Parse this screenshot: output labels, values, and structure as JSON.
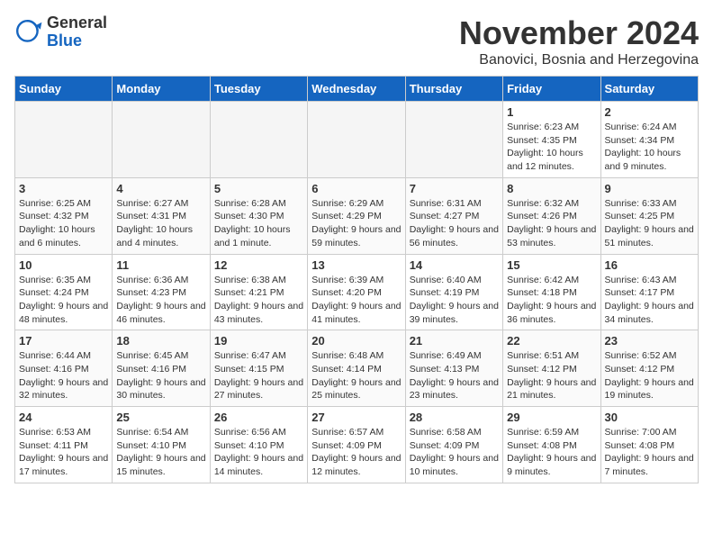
{
  "logo": {
    "general": "General",
    "blue": "Blue"
  },
  "header": {
    "month": "November 2024",
    "location": "Banovici, Bosnia and Herzegovina"
  },
  "weekdays": [
    "Sunday",
    "Monday",
    "Tuesday",
    "Wednesday",
    "Thursday",
    "Friday",
    "Saturday"
  ],
  "weeks": [
    [
      {
        "day": "",
        "info": ""
      },
      {
        "day": "",
        "info": ""
      },
      {
        "day": "",
        "info": ""
      },
      {
        "day": "",
        "info": ""
      },
      {
        "day": "",
        "info": ""
      },
      {
        "day": "1",
        "info": "Sunrise: 6:23 AM\nSunset: 4:35 PM\nDaylight: 10 hours and 12 minutes."
      },
      {
        "day": "2",
        "info": "Sunrise: 6:24 AM\nSunset: 4:34 PM\nDaylight: 10 hours and 9 minutes."
      }
    ],
    [
      {
        "day": "3",
        "info": "Sunrise: 6:25 AM\nSunset: 4:32 PM\nDaylight: 10 hours and 6 minutes."
      },
      {
        "day": "4",
        "info": "Sunrise: 6:27 AM\nSunset: 4:31 PM\nDaylight: 10 hours and 4 minutes."
      },
      {
        "day": "5",
        "info": "Sunrise: 6:28 AM\nSunset: 4:30 PM\nDaylight: 10 hours and 1 minute."
      },
      {
        "day": "6",
        "info": "Sunrise: 6:29 AM\nSunset: 4:29 PM\nDaylight: 9 hours and 59 minutes."
      },
      {
        "day": "7",
        "info": "Sunrise: 6:31 AM\nSunset: 4:27 PM\nDaylight: 9 hours and 56 minutes."
      },
      {
        "day": "8",
        "info": "Sunrise: 6:32 AM\nSunset: 4:26 PM\nDaylight: 9 hours and 53 minutes."
      },
      {
        "day": "9",
        "info": "Sunrise: 6:33 AM\nSunset: 4:25 PM\nDaylight: 9 hours and 51 minutes."
      }
    ],
    [
      {
        "day": "10",
        "info": "Sunrise: 6:35 AM\nSunset: 4:24 PM\nDaylight: 9 hours and 48 minutes."
      },
      {
        "day": "11",
        "info": "Sunrise: 6:36 AM\nSunset: 4:23 PM\nDaylight: 9 hours and 46 minutes."
      },
      {
        "day": "12",
        "info": "Sunrise: 6:38 AM\nSunset: 4:21 PM\nDaylight: 9 hours and 43 minutes."
      },
      {
        "day": "13",
        "info": "Sunrise: 6:39 AM\nSunset: 4:20 PM\nDaylight: 9 hours and 41 minutes."
      },
      {
        "day": "14",
        "info": "Sunrise: 6:40 AM\nSunset: 4:19 PM\nDaylight: 9 hours and 39 minutes."
      },
      {
        "day": "15",
        "info": "Sunrise: 6:42 AM\nSunset: 4:18 PM\nDaylight: 9 hours and 36 minutes."
      },
      {
        "day": "16",
        "info": "Sunrise: 6:43 AM\nSunset: 4:17 PM\nDaylight: 9 hours and 34 minutes."
      }
    ],
    [
      {
        "day": "17",
        "info": "Sunrise: 6:44 AM\nSunset: 4:16 PM\nDaylight: 9 hours and 32 minutes."
      },
      {
        "day": "18",
        "info": "Sunrise: 6:45 AM\nSunset: 4:16 PM\nDaylight: 9 hours and 30 minutes."
      },
      {
        "day": "19",
        "info": "Sunrise: 6:47 AM\nSunset: 4:15 PM\nDaylight: 9 hours and 27 minutes."
      },
      {
        "day": "20",
        "info": "Sunrise: 6:48 AM\nSunset: 4:14 PM\nDaylight: 9 hours and 25 minutes."
      },
      {
        "day": "21",
        "info": "Sunrise: 6:49 AM\nSunset: 4:13 PM\nDaylight: 9 hours and 23 minutes."
      },
      {
        "day": "22",
        "info": "Sunrise: 6:51 AM\nSunset: 4:12 PM\nDaylight: 9 hours and 21 minutes."
      },
      {
        "day": "23",
        "info": "Sunrise: 6:52 AM\nSunset: 4:12 PM\nDaylight: 9 hours and 19 minutes."
      }
    ],
    [
      {
        "day": "24",
        "info": "Sunrise: 6:53 AM\nSunset: 4:11 PM\nDaylight: 9 hours and 17 minutes."
      },
      {
        "day": "25",
        "info": "Sunrise: 6:54 AM\nSunset: 4:10 PM\nDaylight: 9 hours and 15 minutes."
      },
      {
        "day": "26",
        "info": "Sunrise: 6:56 AM\nSunset: 4:10 PM\nDaylight: 9 hours and 14 minutes."
      },
      {
        "day": "27",
        "info": "Sunrise: 6:57 AM\nSunset: 4:09 PM\nDaylight: 9 hours and 12 minutes."
      },
      {
        "day": "28",
        "info": "Sunrise: 6:58 AM\nSunset: 4:09 PM\nDaylight: 9 hours and 10 minutes."
      },
      {
        "day": "29",
        "info": "Sunrise: 6:59 AM\nSunset: 4:08 PM\nDaylight: 9 hours and 9 minutes."
      },
      {
        "day": "30",
        "info": "Sunrise: 7:00 AM\nSunset: 4:08 PM\nDaylight: 9 hours and 7 minutes."
      }
    ]
  ]
}
